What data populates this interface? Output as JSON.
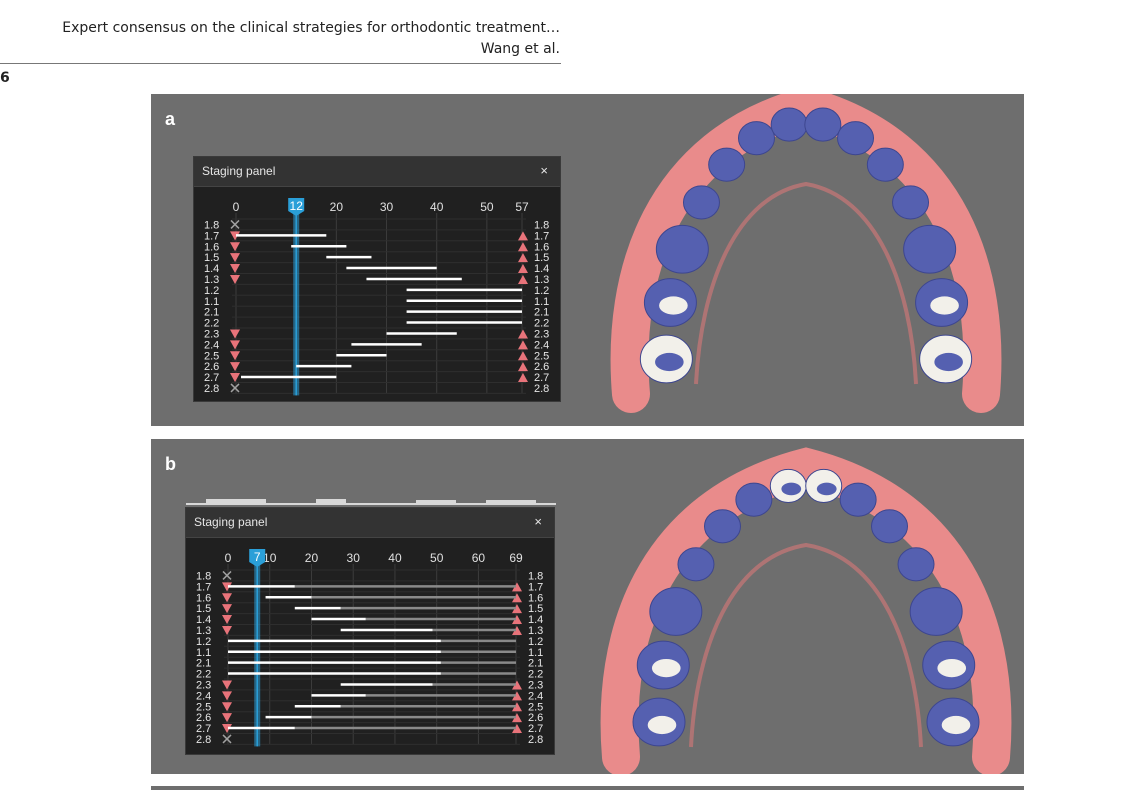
{
  "running_head": {
    "title": "Expert consensus on the clinical strategies for orthodontic treatment…",
    "authors": "Wang et al."
  },
  "page_number": "6",
  "panels": [
    {
      "letter": "a",
      "staging_panel": {
        "title": "Staging panel",
        "close": "×",
        "axis_ticks": [
          "0",
          "20",
          "30",
          "40",
          "50",
          "57"
        ],
        "current_stage": "12",
        "max_stage": 57,
        "teeth": [
          "1.8",
          "1.7",
          "1.6",
          "1.5",
          "1.4",
          "1.3",
          "1.2",
          "1.1",
          "2.1",
          "2.2",
          "2.3",
          "2.4",
          "2.5",
          "2.6",
          "2.7",
          "2.8"
        ],
        "bars": [
          null,
          {
            "start": 0,
            "end": 18
          },
          {
            "start": 11,
            "end": 22
          },
          {
            "start": 18,
            "end": 27
          },
          {
            "start": 22,
            "end": 40
          },
          {
            "start": 26,
            "end": 45
          },
          {
            "start": 34,
            "end": 57
          },
          {
            "start": 34,
            "end": 57
          },
          {
            "start": 34,
            "end": 57
          },
          {
            "start": 34,
            "end": 57
          },
          {
            "start": 30,
            "end": 44
          },
          {
            "start": 23,
            "end": 37
          },
          {
            "start": 20,
            "end": 30
          },
          {
            "start": 12,
            "end": 23
          },
          {
            "start": 1,
            "end": 20
          },
          null
        ],
        "left_markers": [
          "x",
          "down",
          "down",
          "down",
          "down",
          "down",
          "",
          "",
          "",
          "",
          "down",
          "down",
          "down",
          "down",
          "down",
          "x"
        ],
        "right_markers": [
          "",
          "up",
          "up",
          "up",
          "up",
          "up",
          "",
          "",
          "",
          "",
          "up",
          "up",
          "up",
          "up",
          "up",
          ""
        ]
      }
    },
    {
      "letter": "b",
      "staging_panel": {
        "title": "Staging panel",
        "close": "×",
        "axis_ticks": [
          "0",
          "10",
          "20",
          "30",
          "40",
          "50",
          "60",
          "69"
        ],
        "current_stage": "7",
        "max_stage": 69,
        "teeth": [
          "1.8",
          "1.7",
          "1.6",
          "1.5",
          "1.4",
          "1.3",
          "1.2",
          "1.1",
          "2.1",
          "2.2",
          "2.3",
          "2.4",
          "2.5",
          "2.6",
          "2.7",
          "2.8"
        ],
        "bars": [
          null,
          {
            "start": 0,
            "end": 16,
            "passive_end": 69
          },
          {
            "start": 9,
            "end": 20,
            "passive_end": 69
          },
          {
            "start": 16,
            "end": 27,
            "passive_end": 69
          },
          {
            "start": 20,
            "end": 33,
            "passive_end": 69
          },
          {
            "start": 27,
            "end": 49,
            "passive_end": 69
          },
          {
            "start": 0,
            "end": 51,
            "passive_end": 69
          },
          {
            "start": 0,
            "end": 51,
            "passive_end": 69
          },
          {
            "start": 0,
            "end": 51,
            "passive_end": 69
          },
          {
            "start": 0,
            "end": 51,
            "passive_end": 69
          },
          {
            "start": 27,
            "end": 49,
            "passive_end": 69
          },
          {
            "start": 20,
            "end": 33,
            "passive_end": 69
          },
          {
            "start": 16,
            "end": 27,
            "passive_end": 69
          },
          {
            "start": 9,
            "end": 20,
            "passive_end": 69
          },
          {
            "start": 0,
            "end": 16,
            "passive_end": 69
          },
          null
        ],
        "left_markers": [
          "x",
          "down",
          "down",
          "down",
          "down",
          "down",
          "",
          "",
          "",
          "",
          "down",
          "down",
          "down",
          "down",
          "down",
          "x"
        ],
        "right_markers": [
          "",
          "up",
          "up",
          "up",
          "up",
          "up",
          "",
          "",
          "",
          "",
          "up",
          "up",
          "up",
          "up",
          "up",
          ""
        ]
      }
    }
  ],
  "colors": {
    "figure_bg": "#6e6e6e",
    "panel_bg": "#202020",
    "active_bar": "#ffffff",
    "passive_bar": "#8a8a8a",
    "marker": "#e8737a",
    "slider": "#2a9fd8",
    "gingiva": "#e98b8b",
    "attachment": "#5560b0",
    "tooth": "#f2f0ea"
  }
}
